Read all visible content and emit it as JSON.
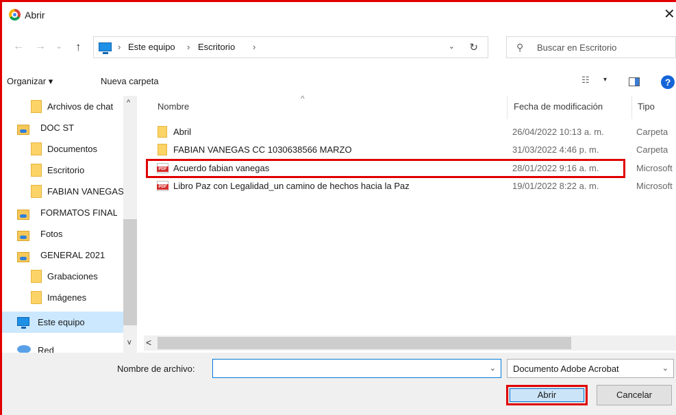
{
  "window": {
    "title": "Abrir",
    "close_glyph": "✕"
  },
  "nav": {
    "back_glyph": "←",
    "forward_glyph": "→",
    "history_glyph": "⌄",
    "up_glyph": "↑",
    "breadcrumbs": [
      "Este equipo",
      "Escritorio"
    ],
    "separator": "›",
    "refresh_glyph": "↻",
    "search_placeholder": "Buscar en Escritorio"
  },
  "toolbar": {
    "organize_label": "Organizar ▾",
    "new_folder_label": "Nueva carpeta",
    "view_glyph": "☷",
    "view_dd": "▾",
    "help_glyph": "?"
  },
  "sidebar": {
    "items": [
      {
        "label": "Archivos de chat",
        "icon": "folder-icon"
      },
      {
        "label": "DOC ST",
        "icon": "network-folder-icon"
      },
      {
        "label": "Documentos",
        "icon": "folder-icon"
      },
      {
        "label": "Escritorio",
        "icon": "folder-icon"
      },
      {
        "label": "FABIAN VANEGAS",
        "icon": "folder-icon"
      },
      {
        "label": "FORMATOS FINALES",
        "icon": "network-folder-icon"
      },
      {
        "label": "Fotos",
        "icon": "network-folder-icon"
      },
      {
        "label": "GENERAL 2021",
        "icon": "network-folder-icon"
      },
      {
        "label": "Grabaciones",
        "icon": "folder-icon"
      },
      {
        "label": "Imágenes",
        "icon": "folder-icon"
      },
      {
        "label": "Este equipo",
        "icon": "computer-icon",
        "selected": true
      },
      {
        "label": "Red",
        "icon": "network-icon"
      }
    ],
    "scroll_up": "^",
    "scroll_down": "v"
  },
  "columns": {
    "name": "Nombre",
    "date": "Fecha de modificación",
    "type": "Tipo",
    "sort_caret": "^"
  },
  "files": [
    {
      "name": "Abril",
      "date": "26/04/2022 10:13 a. m.",
      "type": "Carpeta",
      "icon": "folder-icon"
    },
    {
      "name": "FABIAN VANEGAS CC 1030638566 MARZO",
      "date": "31/03/2022 4:46 p. m.",
      "type": "Carpeta",
      "icon": "folder-icon"
    },
    {
      "name": "Acuerdo fabian vanegas",
      "date": "28/01/2022 9:16 a. m.",
      "type": "Microsoft",
      "icon": "pdf-icon",
      "highlighted": true
    },
    {
      "name": "Libro Paz con Legalidad_un camino de hechos hacia la Paz",
      "date": "19/01/2022 8:22 a. m.",
      "type": "Microsoft",
      "icon": "pdf-icon"
    }
  ],
  "hscroll_left": "<",
  "footer": {
    "filename_label": "Nombre de archivo:",
    "filename_value": "",
    "dd_glyph": "⌄",
    "filetype_value": "Documento Adobe Acrobat",
    "open_label": "Abrir",
    "cancel_label": "Cancelar"
  },
  "colors": {
    "highlight_red": "#e00000",
    "accent_blue": "#0078d7",
    "selection": "#cce8ff"
  }
}
